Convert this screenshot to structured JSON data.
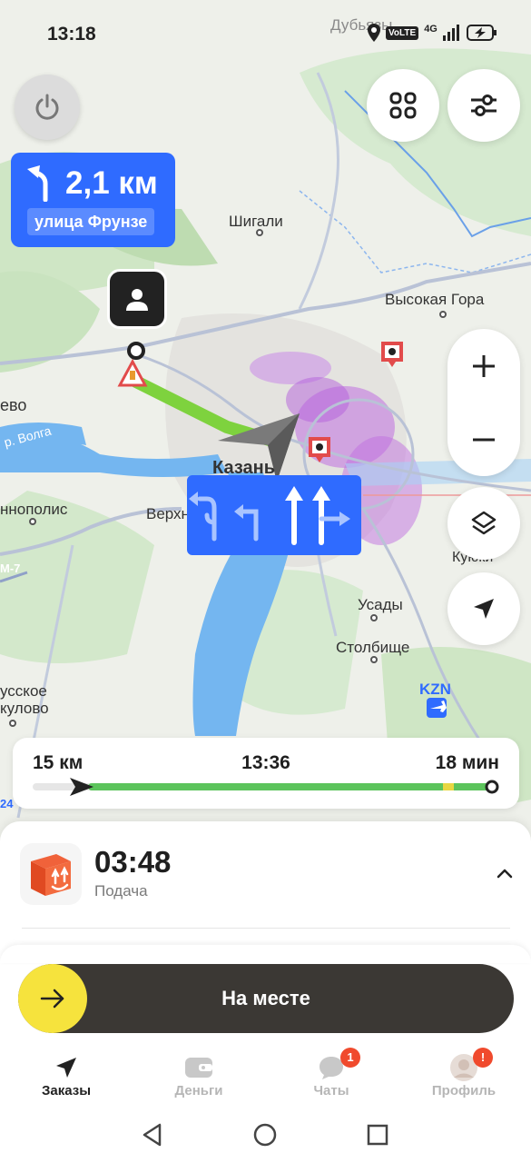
{
  "status_bar": {
    "time": "13:18",
    "city": "Дубьязы",
    "volte": "VoLTE",
    "network": "4G"
  },
  "maneuver": {
    "distance": "2,1 км",
    "street": "улица Фрунзе",
    "color": "#2f6bff"
  },
  "map": {
    "labels": {
      "shigali": "Шигали",
      "vysokaya_gora": "Высокая Гора",
      "kazan": "Казань",
      "verkh": "Верхн",
      "evo": "ево",
      "volga": "р. Волга",
      "innopolis": "ннополис",
      "m7": "М-7",
      "usady": "Усады",
      "stolbishche": "Столбище",
      "kzn": "KZN",
      "kuyuki": "Куюки",
      "russkoe_1": "усское",
      "russkoe_2": "кулово",
      "road_24": "24"
    }
  },
  "route": {
    "distance": "15 км",
    "arrival": "13:36",
    "duration": "18 мин",
    "progress": 0.12
  },
  "order": {
    "timer": "03:48",
    "status": "Подача"
  },
  "action": {
    "label": "На месте"
  },
  "tabs": [
    {
      "label": "Заказы",
      "icon": "navigation-arrow-icon",
      "active": true
    },
    {
      "label": "Деньги",
      "icon": "wallet-icon"
    },
    {
      "label": "Чаты",
      "icon": "chat-icon",
      "badge": "1"
    },
    {
      "label": "Профиль",
      "icon": "avatar-icon",
      "badge": "!"
    }
  ],
  "colors": {
    "accent_yellow": "#f6e33d",
    "route_green": "#5cc45c",
    "badge_red": "#f04a2d",
    "dark_button": "#3b3834"
  }
}
